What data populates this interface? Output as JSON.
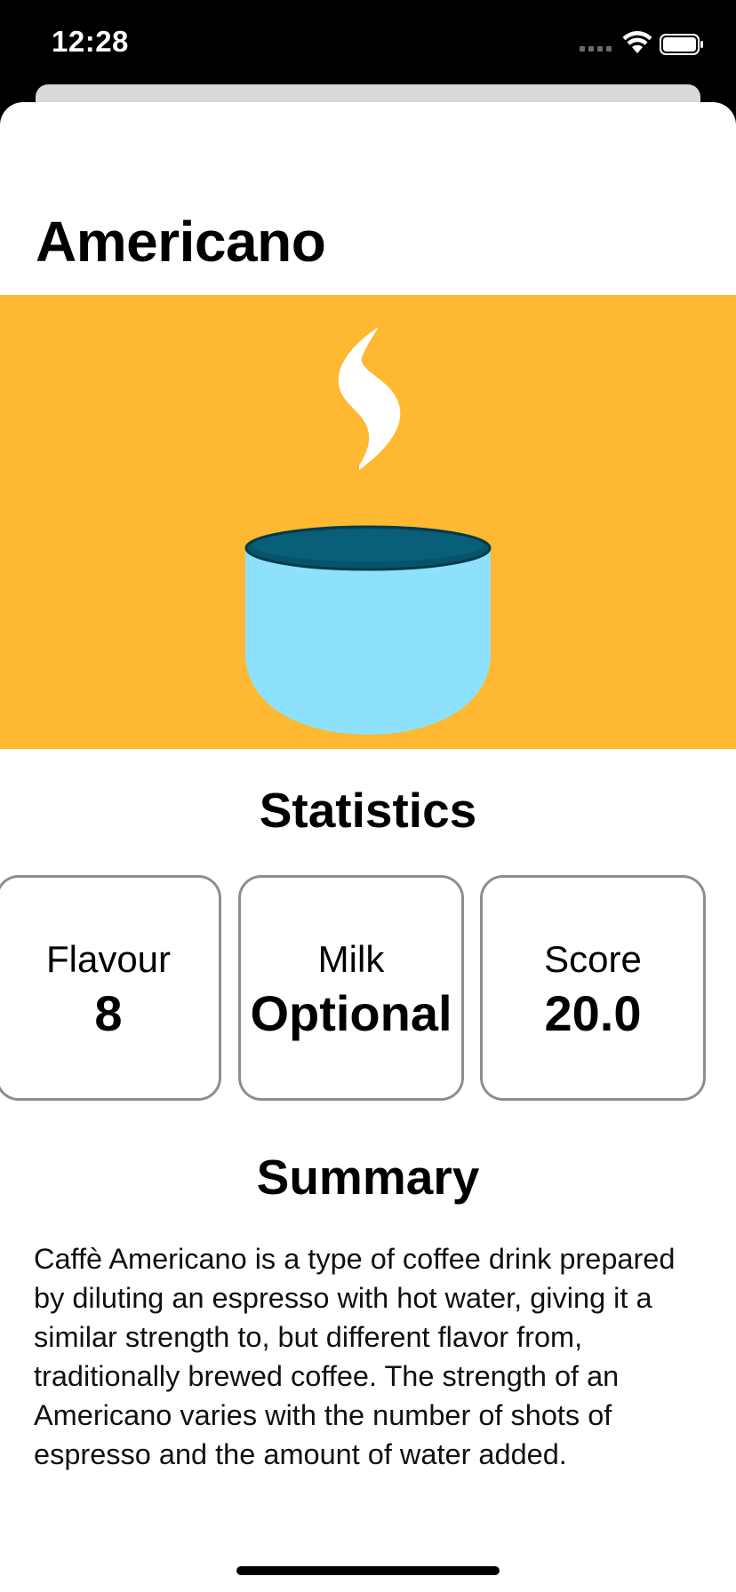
{
  "status_bar": {
    "time": "12:28"
  },
  "drink": {
    "name": "Americano",
    "hero_color": "#feb831"
  },
  "statistics": {
    "title": "Statistics",
    "items": [
      {
        "label": "Flavour",
        "value": "8"
      },
      {
        "label": "Milk",
        "value": "Optional"
      },
      {
        "label": "Score",
        "value": "20.0"
      }
    ]
  },
  "summary": {
    "title": "Summary",
    "text": "Caffè Americano is a type of coffee drink prepared by diluting an espresso with hot water, giving it a similar strength to, but different flavor from, traditionally brewed coffee. The strength of an Americano varies with the number of shots of espresso and the amount of water added."
  },
  "icons": {
    "hero": "coffee-cup-icon",
    "wifi": "wifi-icon",
    "battery": "battery-icon"
  }
}
